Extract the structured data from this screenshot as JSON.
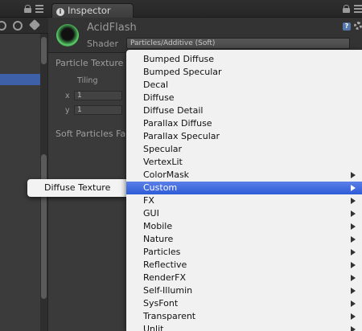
{
  "inspector": {
    "tab_label": "Inspector",
    "material_name": "AcidFlash",
    "shader_label": "Shader",
    "shader_value": "Particles/Additive (Soft)",
    "particle_texture_label": "Particle Texture",
    "tiling_label": "Tiling",
    "x_label": "x",
    "y_label": "y",
    "x_value": "1",
    "y_value": "1",
    "soft_particles_label": "Soft Particles Fac"
  },
  "submenu": {
    "items": [
      "Diffuse Texture"
    ]
  },
  "menu": {
    "items": [
      {
        "label": "Bumped Diffuse",
        "has_submenu": false
      },
      {
        "label": "Bumped Specular",
        "has_submenu": false
      },
      {
        "label": "Decal",
        "has_submenu": false
      },
      {
        "label": "Diffuse",
        "has_submenu": false
      },
      {
        "label": "Diffuse Detail",
        "has_submenu": false
      },
      {
        "label": "Parallax Diffuse",
        "has_submenu": false
      },
      {
        "label": "Parallax Specular",
        "has_submenu": false
      },
      {
        "label": "Specular",
        "has_submenu": false
      },
      {
        "label": "VertexLit",
        "has_submenu": false
      },
      {
        "label": "ColorMask",
        "has_submenu": true
      },
      {
        "label": "Custom",
        "has_submenu": true,
        "highlighted": true
      },
      {
        "label": "FX",
        "has_submenu": true
      },
      {
        "label": "GUI",
        "has_submenu": true
      },
      {
        "label": "Mobile",
        "has_submenu": true
      },
      {
        "label": "Nature",
        "has_submenu": true
      },
      {
        "label": "Particles",
        "has_submenu": true
      },
      {
        "label": "Reflective",
        "has_submenu": true
      },
      {
        "label": "RenderFX",
        "has_submenu": true
      },
      {
        "label": "Self-Illumin",
        "has_submenu": true
      },
      {
        "label": "SysFont",
        "has_submenu": true
      },
      {
        "label": "Transparent",
        "has_submenu": true
      },
      {
        "label": "Unlit",
        "has_submenu": true
      }
    ]
  },
  "colors": {
    "highlight": "#2e5cd6",
    "selection": "#3d60a8"
  }
}
